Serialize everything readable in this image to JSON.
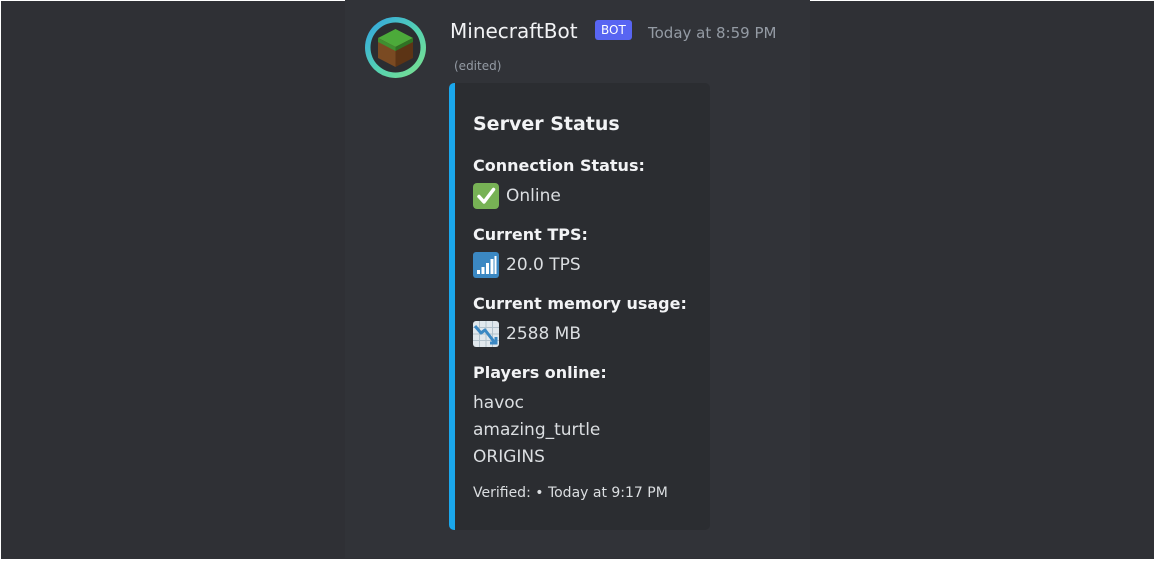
{
  "message": {
    "author": "MinecraftBot",
    "badge": "BOT",
    "timestamp": "Today at 8:59 PM",
    "edited": "(edited)",
    "avatar_icon": "grass-block-icon"
  },
  "embed": {
    "accent_color": "#1aa7ec",
    "title": "Server Status",
    "fields": [
      {
        "name": "Connection Status:",
        "value": "Online",
        "icon": "check-mark-button-icon"
      },
      {
        "name": "Current TPS:",
        "value": "20.0 TPS",
        "icon": "signal-bars-icon"
      },
      {
        "name": "Current memory usage:",
        "value": "2588 MB",
        "icon": "chart-decreasing-icon"
      },
      {
        "name": "Players online:",
        "players": [
          "havoc",
          "amazing_turtle",
          "ORIGINS"
        ]
      }
    ],
    "footer": "Verified: • Today at 9:17 PM"
  },
  "colors": {
    "background": "#313338",
    "embed_background": "#2b2d31",
    "bot_badge": "#5865f2",
    "text_primary": "#f2f3f5",
    "text_muted": "#949ba4"
  }
}
